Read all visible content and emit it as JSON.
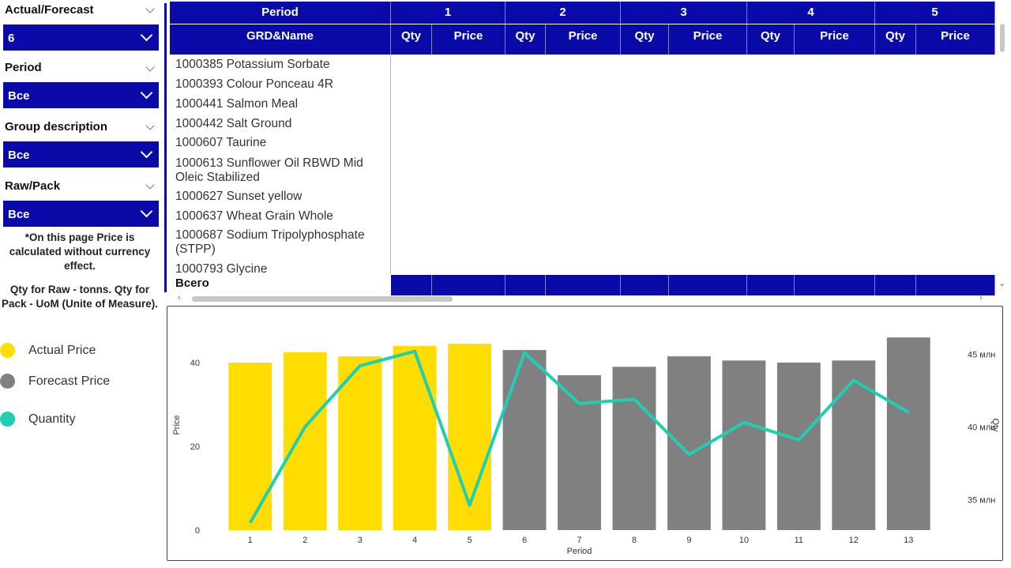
{
  "filters": {
    "actual_forecast": {
      "label": "Actual/Forecast",
      "value": "6"
    },
    "period": {
      "label": "Period",
      "value": "Все"
    },
    "group_description": {
      "label": "Group description",
      "value": "Все"
    },
    "raw_pack": {
      "label": "Raw/Pack",
      "value": "Все"
    }
  },
  "notes": {
    "price_note": "*On this page Price is calculated without currency effect.",
    "qty_note": "Qty for Raw - tonns. Qty for Pack - UoM (Unite of Measure)."
  },
  "legend": [
    {
      "label": "Actual Price",
      "color": "#ffdd00"
    },
    {
      "label": "Forecast Price",
      "color": "#808080"
    },
    {
      "label": "Quantity",
      "color": "#1fcfb2"
    }
  ],
  "table": {
    "period_header": "Period",
    "name_header": "GRD&Name",
    "periods": [
      "1",
      "2",
      "3",
      "4",
      "5"
    ],
    "qty_header": "Qty",
    "price_header": "Price",
    "rows": [
      "1000385 Potassium Sorbate",
      "1000393 Colour Ponceau 4R",
      "1000441 Salmon Meal",
      "1000442 Salt Ground",
      "1000607 Taurine",
      "1000613 Sunflower Oil RBWD Mid Oleic Stabilized",
      "1000627 Sunset yellow",
      "1000637 Wheat Grain Whole",
      "1000687 Sodium Tripolyphosphate (STPP)",
      "1000793 Glycine"
    ],
    "total_label": "Всего"
  },
  "chart_data": {
    "type": "bar",
    "categories": [
      "1",
      "2",
      "3",
      "4",
      "5",
      "6",
      "7",
      "8",
      "9",
      "10",
      "11",
      "12",
      "13"
    ],
    "series": [
      {
        "name": "Actual Price",
        "values": [
          40,
          42.5,
          41.5,
          44,
          44.5,
          null,
          null,
          null,
          null,
          null,
          null,
          null,
          null
        ]
      },
      {
        "name": "Forecast Price",
        "values": [
          null,
          null,
          null,
          null,
          null,
          43,
          37,
          39,
          41.5,
          40.5,
          40,
          40.5,
          46
        ]
      },
      {
        "name": "Quantity",
        "axis": "right",
        "values": [
          33.4,
          40,
          44.2,
          45.2,
          34.6,
          45.1,
          41.6,
          41.9,
          38.1,
          40.3,
          39.1,
          43.2,
          41
        ]
      }
    ],
    "xlabel": "Period",
    "ylabel": "Price",
    "y2label": "Qty",
    "ylim": [
      0,
      50
    ],
    "yticks": [
      "0",
      "20",
      "40"
    ],
    "y2lim": [
      32.9,
      47.3
    ],
    "y2ticks": [
      "35 млн",
      "40 млн",
      "45 млн"
    ],
    "legend": "left"
  }
}
